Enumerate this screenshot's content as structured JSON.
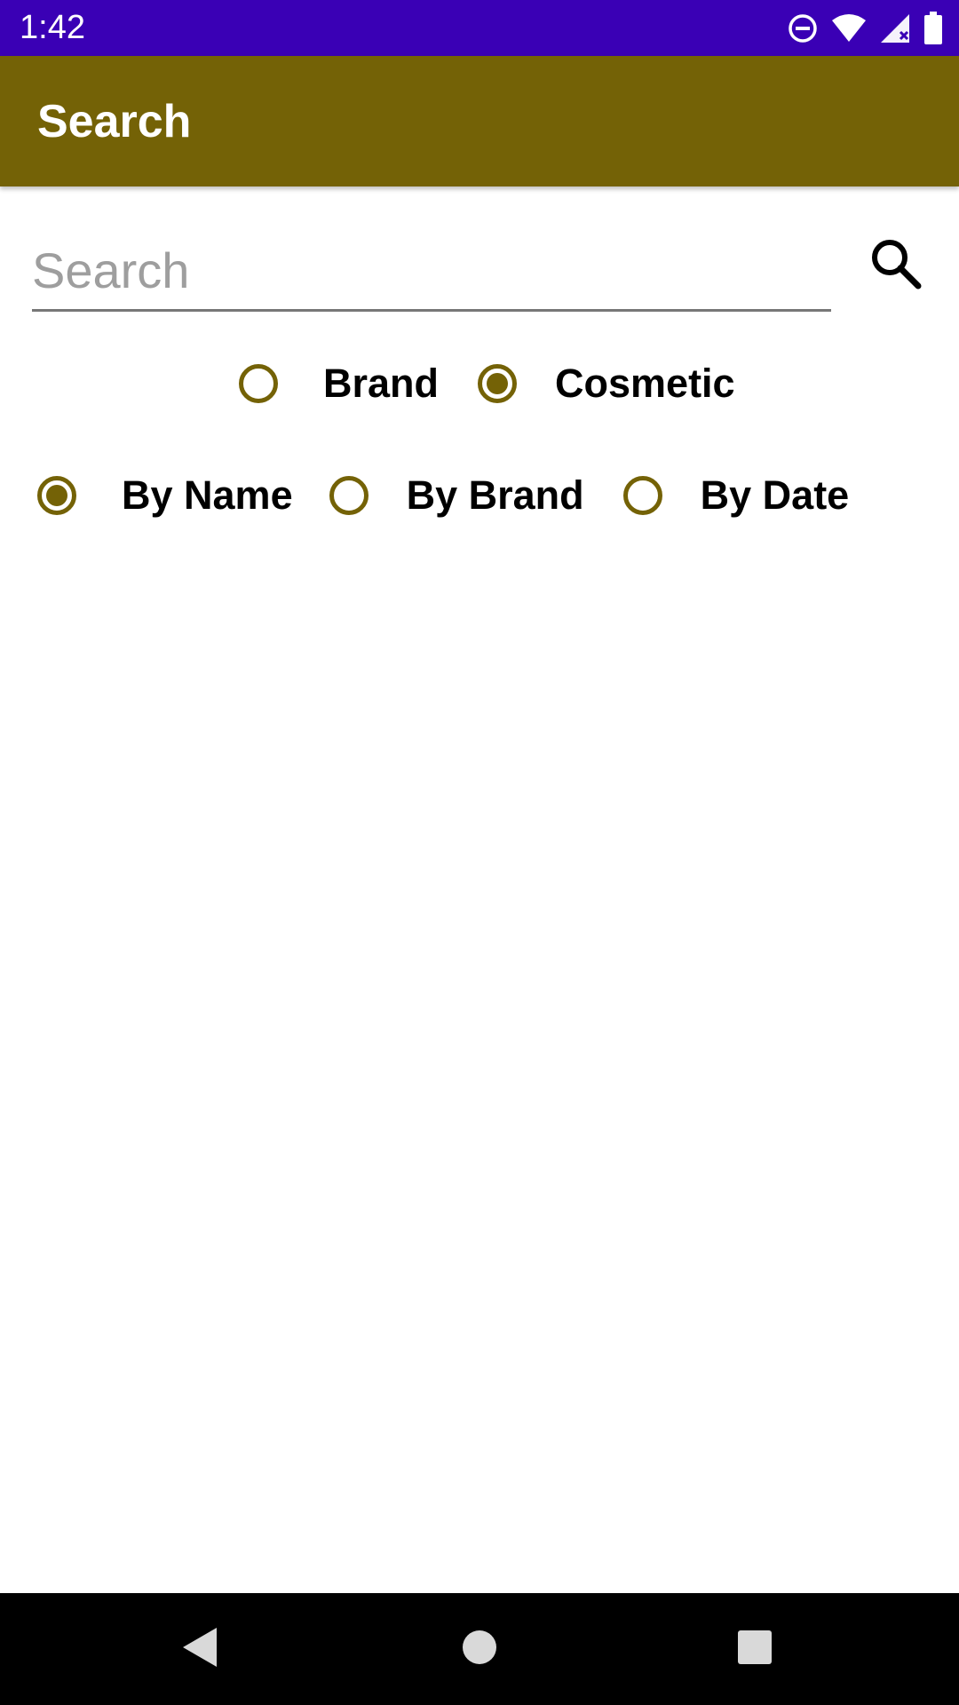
{
  "status_bar": {
    "time": "1:42",
    "background": "#3A00B5",
    "icons": [
      "do-not-disturb-icon",
      "wifi-icon",
      "signal-icon",
      "battery-icon"
    ]
  },
  "app_bar": {
    "title": "Search",
    "background": "#746206"
  },
  "search": {
    "placeholder": "Search",
    "value": "",
    "button_icon": "search-icon"
  },
  "type_filter": {
    "options": [
      {
        "label": "Brand",
        "checked": false
      },
      {
        "label": "Cosmetic",
        "checked": true
      }
    ]
  },
  "sort_filter": {
    "options": [
      {
        "label": "By Name",
        "checked": true
      },
      {
        "label": "By Brand",
        "checked": false
      },
      {
        "label": "By Date",
        "checked": false
      }
    ]
  },
  "accent_color": "#746206",
  "nav_bar": {
    "buttons": [
      "back-icon",
      "home-icon",
      "recents-icon"
    ]
  }
}
